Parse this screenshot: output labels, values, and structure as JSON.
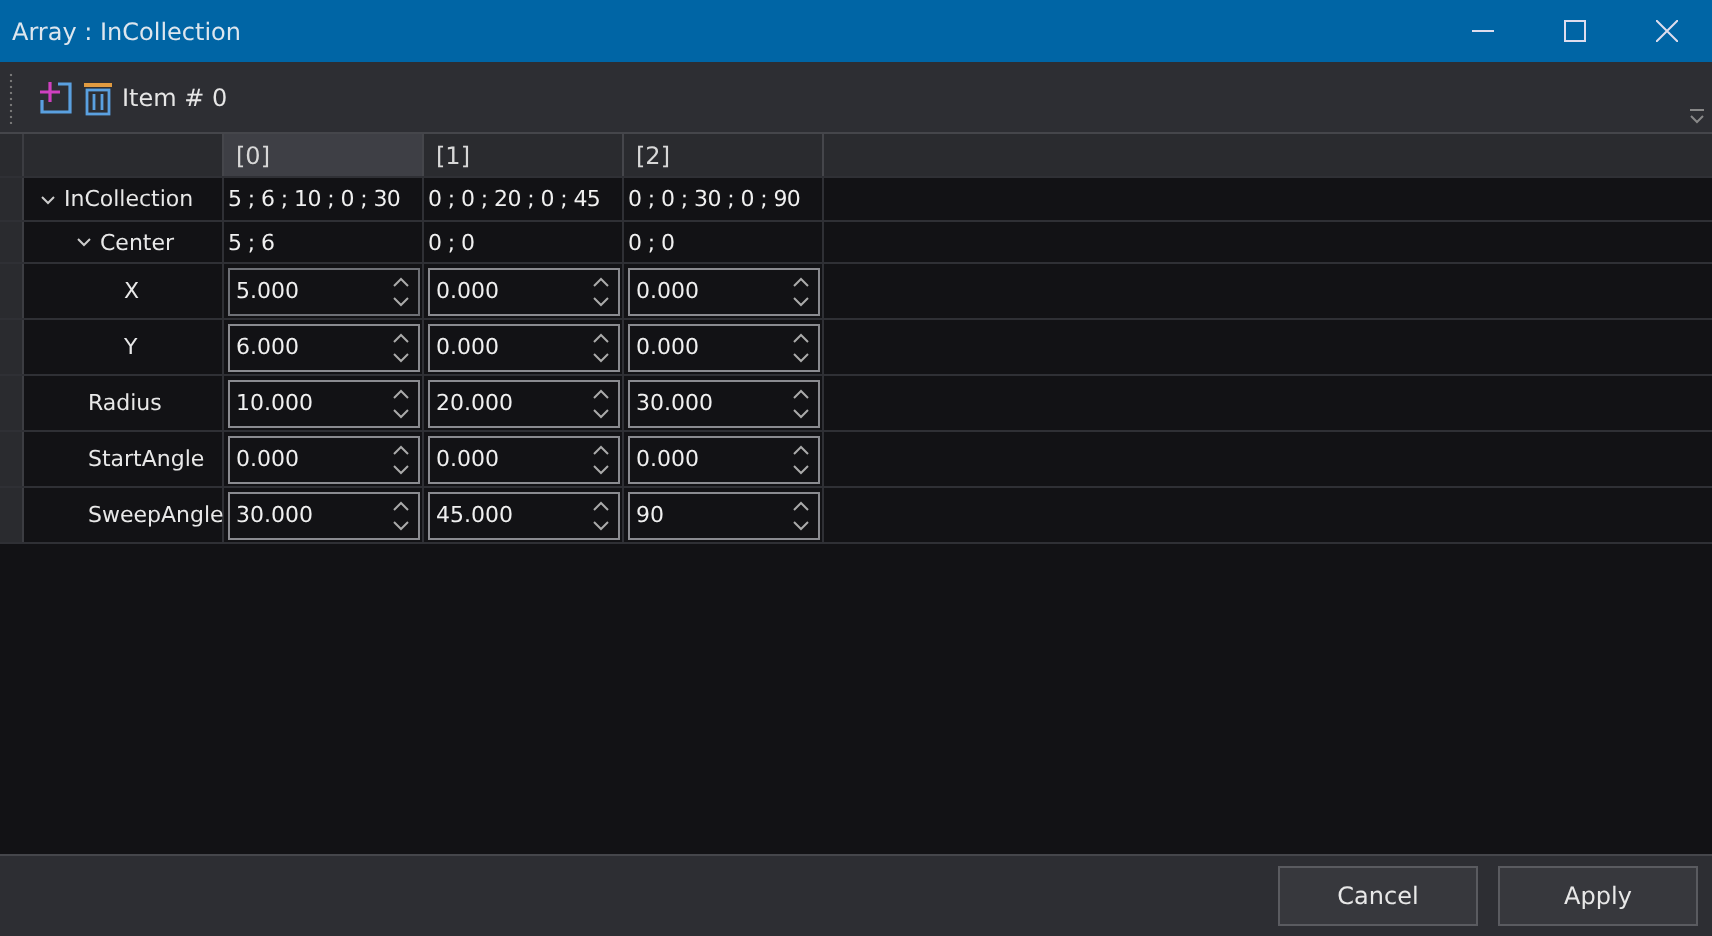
{
  "window": {
    "title": "Array : InCollection"
  },
  "toolbar": {
    "item_label": "Item # 0"
  },
  "columns": [
    {
      "label": "[0]",
      "selected": true
    },
    {
      "label": "[1]",
      "selected": false
    },
    {
      "label": "[2]",
      "selected": false
    }
  ],
  "rows": [
    {
      "kind": "group",
      "name": "InCollection",
      "expanded": true,
      "values": [
        "5 ; 6 ; 10 ; 0 ; 30",
        "0 ; 0 ; 20 ; 0 ; 45",
        "0 ; 0 ; 30 ; 0 ; 90"
      ],
      "children": [
        {
          "kind": "group",
          "name": "Center",
          "expanded": true,
          "values": [
            "5 ; 6",
            "0 ; 0",
            "0 ; 0"
          ],
          "children": [
            {
              "kind": "field",
              "name": "X",
              "values": [
                "5.000",
                "0.000",
                "0.000"
              ]
            },
            {
              "kind": "field",
              "name": "Y",
              "values": [
                "6.000",
                "0.000",
                "0.000"
              ]
            }
          ]
        },
        {
          "kind": "field",
          "name": "Radius",
          "values": [
            "10.000",
            "20.000",
            "30.000"
          ]
        },
        {
          "kind": "field",
          "name": "StartAngle",
          "values": [
            "0.000",
            "0.000",
            "0.000"
          ]
        },
        {
          "kind": "field",
          "name": "SweepAngle",
          "values": [
            "30.000",
            "45.000",
            "90"
          ]
        }
      ]
    }
  ],
  "buttons": [
    "Cancel",
    "Apply"
  ]
}
